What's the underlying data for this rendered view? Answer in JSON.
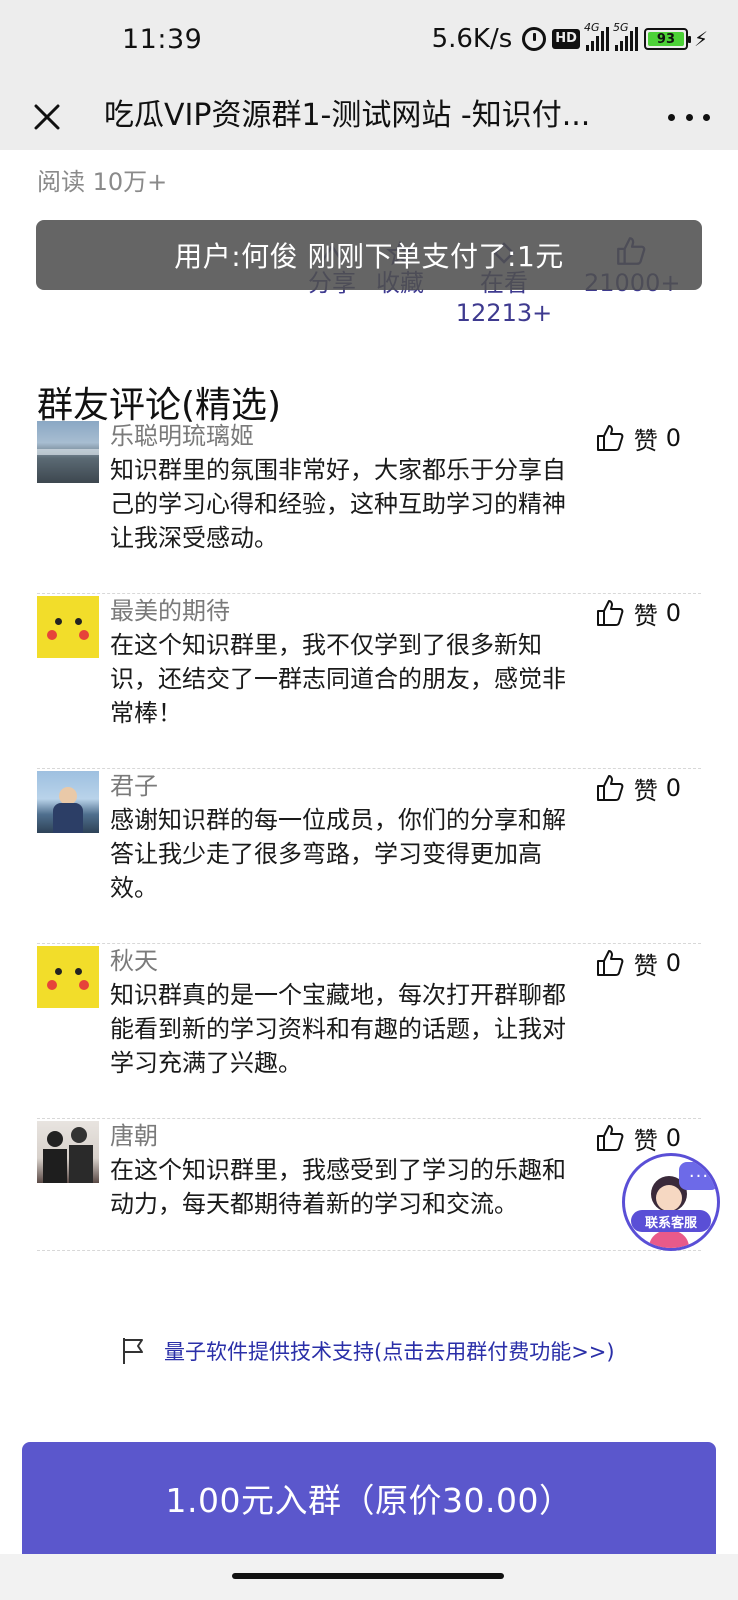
{
  "status_bar": {
    "time": "11:39",
    "net_speed": "5.6K/s",
    "hd_label": "HD",
    "signal1_label": "4G",
    "signal2_label": "5G",
    "battery_level": "93",
    "icons": [
      "alarm-icon",
      "hd-icon",
      "signal-4g-icon",
      "signal-5g-icon",
      "battery-icon",
      "charging-icon"
    ]
  },
  "nav": {
    "title": "吃瓜VIP资源群1-测试网站 -知识付...",
    "close_icon": "close-icon",
    "more_icon": "more-icon"
  },
  "article": {
    "read_count": "阅读 10万+"
  },
  "actions": {
    "share": "分享",
    "favorite": "收藏",
    "watching": "在看12213+",
    "likes": "21000+"
  },
  "toast": {
    "text": "用户:何俊 刚刚下单支付了:1元"
  },
  "comments": {
    "title": "群友评论(精选)",
    "like_label": "赞",
    "items": [
      {
        "name": "乐聪明琉璃姬",
        "text": "知识群里的氛围非常好，大家都乐于分享自己的学习心得和经验，这种互助学习的精神让我深受感动。",
        "likes": "0"
      },
      {
        "name": "最美的期待",
        "text": "在这个知识群里，我不仅学到了很多新知识，还结交了一群志同道合的朋友，感觉非常棒！",
        "likes": "0"
      },
      {
        "name": "君子",
        "text": "感谢知识群的每一位成员，你们的分享和解答让我少走了很多弯路，学习变得更加高效。",
        "likes": "0"
      },
      {
        "name": "秋天",
        "text": "知识群真的是一个宝藏地，每次打开群聊都能看到新的学习资料和有趣的话题，让我对学习充满了兴趣。",
        "likes": "0"
      },
      {
        "name": "唐朝",
        "text": "在这个知识群里，我感受到了学习的乐趣和动力，每天都期待着新的学习和交流。",
        "likes": "0"
      }
    ]
  },
  "support": {
    "text": "量子软件提供技术支持(点击去用群付费功能>>)"
  },
  "customer_service": {
    "bubble": "···",
    "label": "联系客服"
  },
  "join_button": {
    "label": "1.00元入群（原价30.00）"
  },
  "colors": {
    "accent": "#5b57cc",
    "link": "#2a2fa8",
    "action_text": "#3e3a8f",
    "toast_bg": "#505050",
    "battery": "#4cd137"
  }
}
